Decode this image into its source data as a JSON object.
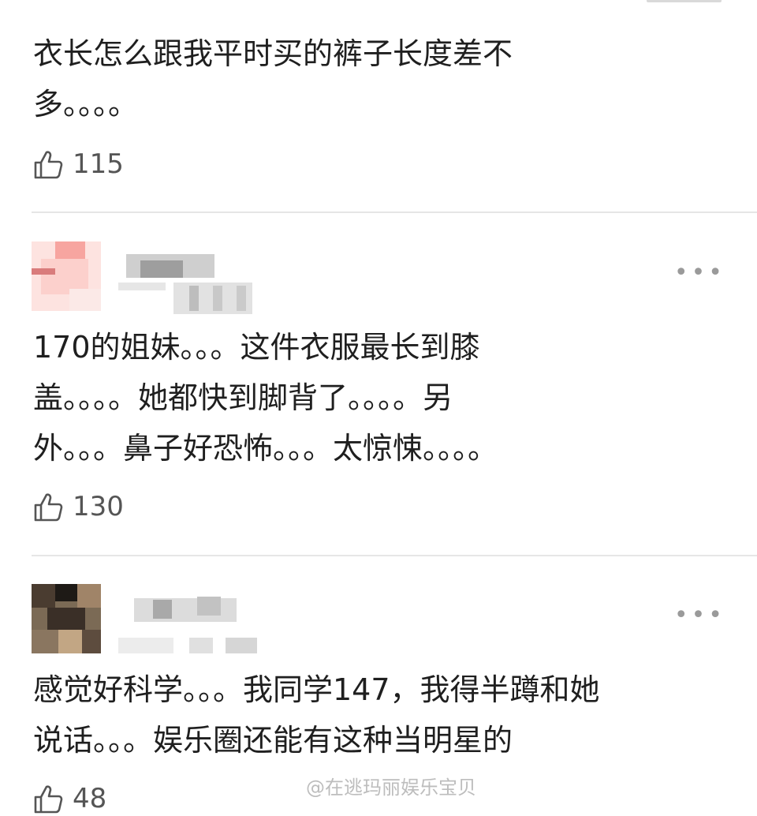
{
  "comments": [
    {
      "text": "衣长怎么跟我平时买的裤子长度差不\n多。。。。",
      "likes": "115"
    },
    {
      "text": "170的姐妹。。。这件衣服最长到膝\n盖。。。。她都快到脚背了。。。。另\n外。。。鼻子好恐怖。。。太惊悚。。。。",
      "likes": "130"
    },
    {
      "text": "感觉好科学。。。我同学147，我得半蹲和她\n说话。。。娱乐圈还能有这种当明星的",
      "likes": "48"
    }
  ],
  "more_label": "•••",
  "watermark": "@在逃玛丽娱乐宝贝",
  "icons": {
    "like": "thumbs-up-icon",
    "more": "more-dots-icon"
  },
  "colors": {
    "text": "#1f1f1f",
    "muted": "#555555",
    "divider": "#e6e6e6"
  }
}
